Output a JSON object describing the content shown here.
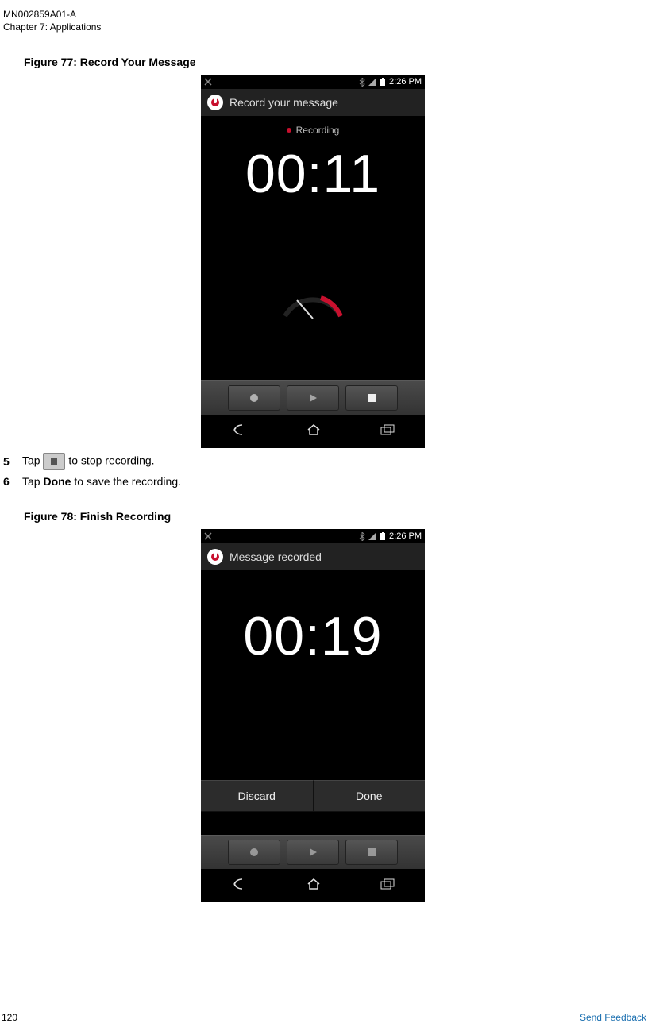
{
  "header": {
    "doc_id": "MN002859A01-A",
    "chapter": "Chapter 7:  Applications"
  },
  "figure1": {
    "caption": "Figure 77: Record Your Message",
    "status_time": "2:26 PM",
    "title": "Record your message",
    "subtitle": "Recording",
    "timer": "00:11"
  },
  "steps": {
    "s5_pre": "Tap",
    "s5_post": "to stop recording.",
    "s6_pre": "Tap",
    "s6_bold": "Done",
    "s6_post": "to save the recording."
  },
  "figure2": {
    "caption": "Figure 78: Finish Recording",
    "status_time": "2:26 PM",
    "title": "Message recorded",
    "timer": "00:19",
    "discard": "Discard",
    "done": "Done"
  },
  "footer": {
    "page": "120",
    "feedback": "Send Feedback"
  }
}
